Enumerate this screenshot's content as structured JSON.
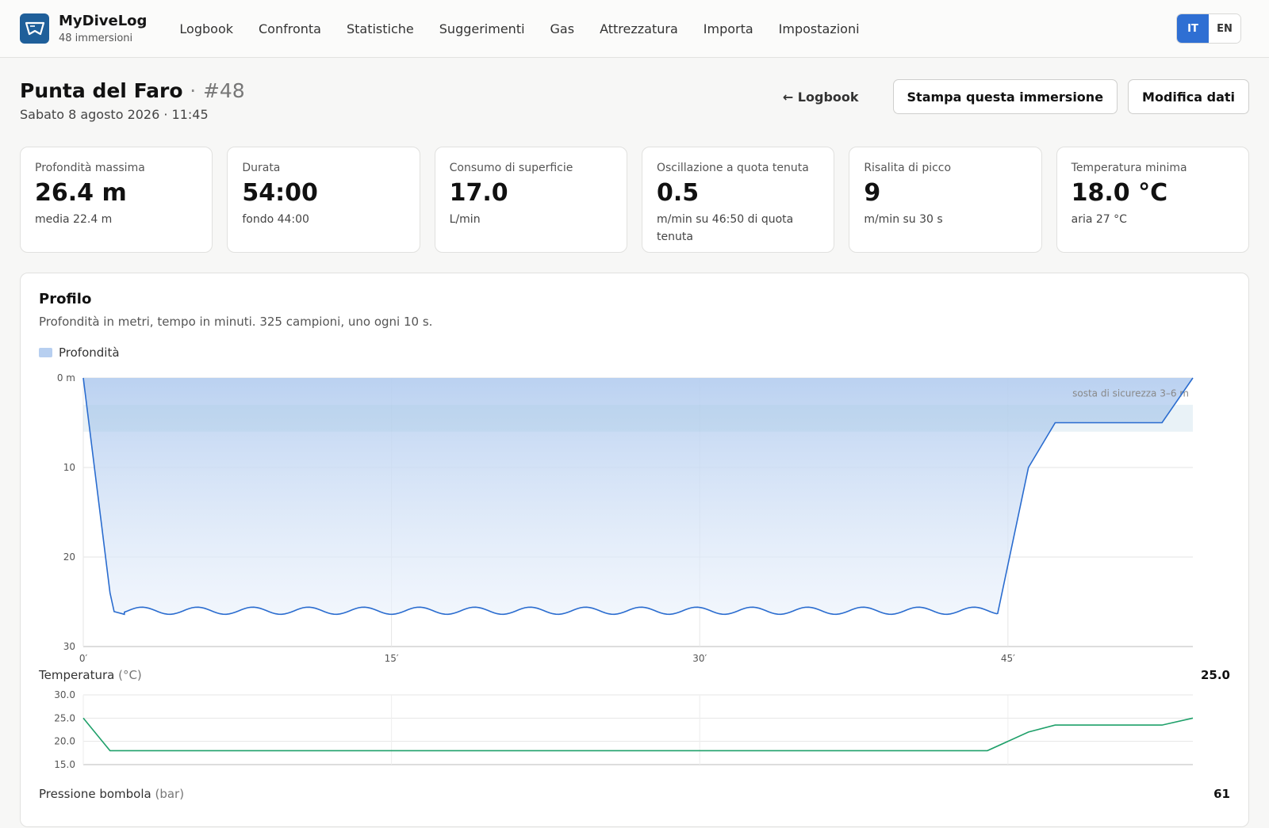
{
  "app": {
    "name": "MyDiveLog",
    "subtitle": "48 immersioni",
    "logo_icon": "dive-mask-icon"
  },
  "nav": [
    "Logbook",
    "Confronta",
    "Statistiche",
    "Suggerimenti",
    "Gas",
    "Attrezzatura",
    "Importa",
    "Impostazioni"
  ],
  "lang": {
    "it": "IT",
    "en": "EN",
    "active": "IT"
  },
  "dive": {
    "site": "Punta del Faro",
    "separator": "·",
    "number": "#48",
    "datetime": "Sabato 8 agosto 2026 · 11:45"
  },
  "actions": {
    "back": "← Logbook",
    "print": "Stampa questa immersione",
    "edit": "Modifica dati"
  },
  "stats": [
    {
      "label": "Profondità massima",
      "value": "26.4 m",
      "sub": "media 22.4 m"
    },
    {
      "label": "Durata",
      "value": "54:00",
      "sub": "fondo 44:00"
    },
    {
      "label": "Consumo di superficie",
      "value": "17.0",
      "sub": "L/min"
    },
    {
      "label": "Oscillazione a quota tenuta",
      "value": "0.5",
      "sub": "m/min su 46:50 di quota tenuta"
    },
    {
      "label": "Risalita di picco",
      "value": "9",
      "sub": "m/min su 30 s"
    },
    {
      "label": "Temperatura minima",
      "value": "18.0 °C",
      "sub": "aria 27 °C"
    }
  ],
  "profile": {
    "title": "Profilo",
    "description": "Profondità in metri, tempo in minuti. 325 campioni, uno ogni 10 s.",
    "legend": "Profondità",
    "safety_stop_label": "sosta di sicurezza 3–6 m",
    "temperature_label": "Temperatura",
    "temperature_unit": "(°C)",
    "temperature_current": "25.0",
    "pressure_label": "Pressione bombola",
    "pressure_unit": "(bar)",
    "pressure_current": "61"
  },
  "chart_data": [
    {
      "type": "area",
      "title": "",
      "xlabel": "",
      "ylabel": "",
      "xlim": [
        0,
        54
      ],
      "ylim": [
        30,
        0
      ],
      "y_inverted": true,
      "xticks": [
        "0′",
        "15′",
        "30′",
        "45′"
      ],
      "xtick_values": [
        0,
        15,
        30,
        45
      ],
      "yticks": [
        "0 m",
        "10",
        "20",
        "30"
      ],
      "ytick_values": [
        0,
        10,
        20,
        30
      ],
      "safety_band": [
        3,
        6
      ],
      "grid": true,
      "color": "#2a6ccf",
      "fill": "#b7cff0",
      "series": [
        {
          "name": "Profondità",
          "x": [
            0,
            1.3,
            1.5,
            2,
            44.5,
            46,
            47.3,
            52.5,
            54
          ],
          "y": [
            0,
            24,
            26.1,
            26.4,
            26.3,
            10,
            5,
            5,
            0
          ],
          "oscillation": {
            "x_start": 1.5,
            "x_end": 44.5,
            "center": 26.0,
            "amplitude": 0.4,
            "period": 2.7
          }
        }
      ]
    },
    {
      "type": "line",
      "title": "",
      "ylabel": "Temperatura (°C)",
      "xlim": [
        0,
        54
      ],
      "ylim": [
        15,
        30
      ],
      "yticks": [
        "30.0",
        "25.0",
        "20.0",
        "15.0"
      ],
      "ytick_values": [
        30,
        25,
        20,
        15
      ],
      "grid": true,
      "color": "#1fa06a",
      "series": [
        {
          "name": "Temperatura",
          "x": [
            0,
            1.3,
            44,
            46,
            47.3,
            52.5,
            54
          ],
          "y": [
            25,
            18,
            18,
            22,
            23.5,
            23.5,
            25
          ]
        }
      ]
    }
  ]
}
